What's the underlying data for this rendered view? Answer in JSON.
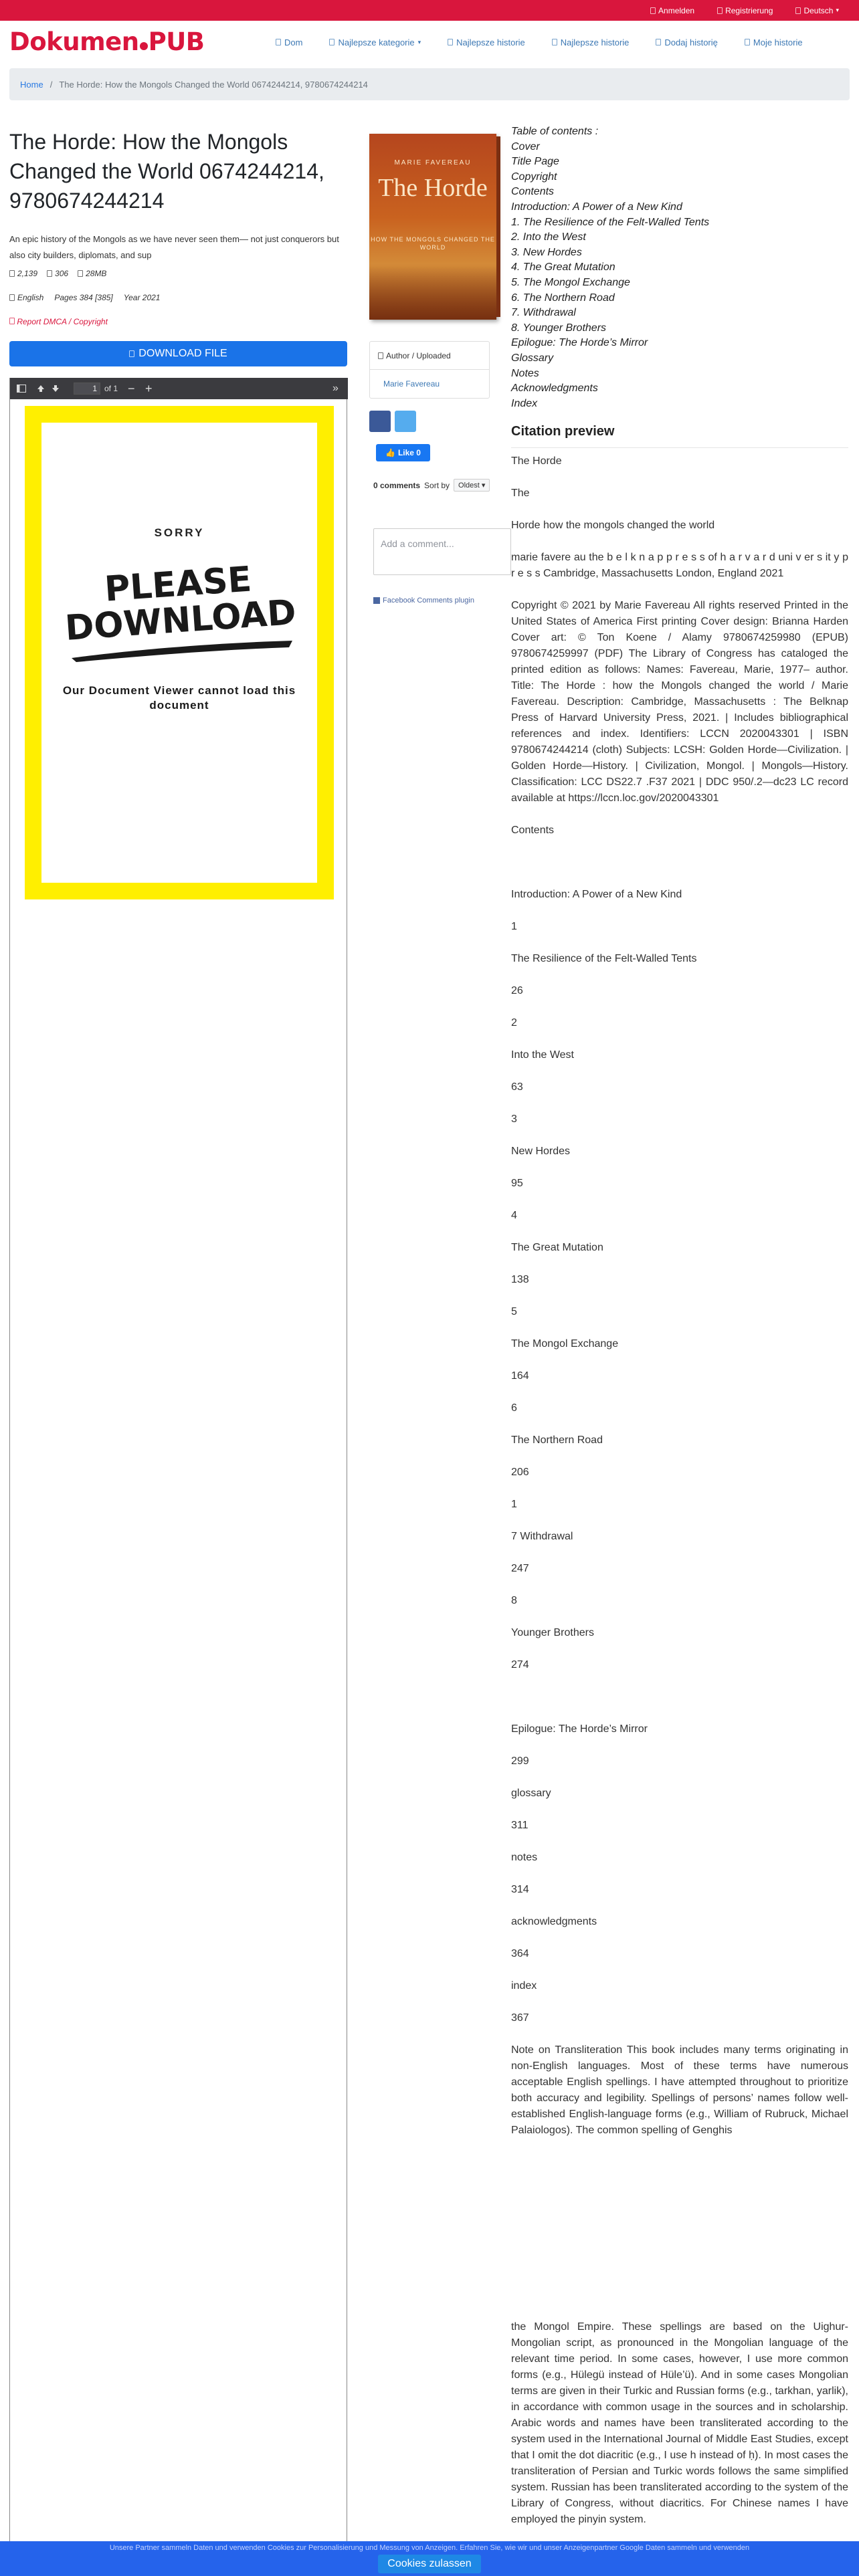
{
  "topbar": {
    "login": "Anmelden",
    "register": "Registrierung",
    "language": "Deutsch"
  },
  "logo": {
    "part1": "Dokumen",
    "part2": "PUB"
  },
  "nav": {
    "home": "Dom",
    "categories": "Najlepsze kategorie",
    "top_stories": "Najlepsze historie",
    "best_stories": "Najlepsze historie",
    "add_story": "Dodaj historię",
    "my_stories": "Moje historie"
  },
  "breadcrumb": {
    "home": "Home",
    "separator": "/",
    "current": "The Horde: How the Mongols Changed the World 0674244214, 9780674244214"
  },
  "book": {
    "title": "The Horde: How the Mongols Changed the World 0674244214, 9780674244214",
    "description": "An epic history of the Mongols as we have never seen them— not just conquerors but also city builders, diplomats, and sup",
    "views": "2,139",
    "downloads": "306",
    "size": "28MB",
    "language": "English",
    "pages": "Pages 384 [385]",
    "year": "Year 2021",
    "report": "Report DMCA / Copyright",
    "download_button": "DOWNLOAD FILE"
  },
  "viewer": {
    "page_current": "1",
    "page_total": "of 1",
    "sorry": "SORRY",
    "please_download": "PLEASE DOWNLOAD",
    "cannot_load": "Our Document Viewer cannot load this document"
  },
  "cover": {
    "author": "MARIE FAVEREAU",
    "title": "The Horde",
    "subtitle": "HOW THE MONGOLS CHANGED THE WORLD"
  },
  "author_card": {
    "heading": "Author / Uploaded",
    "name": "Marie Favereau"
  },
  "social": {
    "like": "Like 0",
    "comments_count": "0 comments",
    "sort_by": "Sort by",
    "sort_value": "Oldest",
    "comment_placeholder": "Add a comment...",
    "plugin": "Facebook Comments plugin"
  },
  "toc": {
    "heading": "Table of contents :",
    "items": [
      "Cover",
      "Title Page",
      "Copyright",
      "Contents",
      "Introduction: A Power of a New Kind",
      "1. The Resilience of the Felt-Walled Tents",
      "2. Into the West",
      "3. New Hordes",
      "4. The Great Mutation",
      "5. The Mongol Exchange",
      "6. The Northern Road",
      "7. Withdrawal",
      "8. Younger Brothers",
      "Epilogue: The Horde’s Mirror",
      "Glossary",
      "Notes",
      "Acknowledgments",
      "Index"
    ]
  },
  "citation": {
    "heading": "Citation preview",
    "paragraphs": [
      "The Horde",
      "The",
      "Horde how the mongols changed the world",
      "marie favere au the b e l k n a p p r e s s of h a r v a r d uni v er s it y p r e s s Cambridge, Massachusetts London, England 2021",
      "Copyright © 2021 by Marie Favereau All rights reserved Printed in the United States of America First printing Cover design: Brianna Harden Cover art: © Ton Koene / Alamy 9780674259980 (EPUB) 9780674259997 (PDF) The Library of Congress has cataloged the printed edition as follows: Names: Favereau, Marie, 1977– author. Title: The Horde : how the Mongols changed the world / Marie Favereau. Description: Cambridge, Massachusetts : The Belknap Press of Harvard University Press, 2021. | Includes bibliographical references and index. Identifiers: LCCN 2020043301 | ISBN 9780674244214 (cloth) Subjects: LCSH: Golden Horde—Civilization. | Golden Horde—History. | Civilization, Mongol. | Mongols—History. Classification: LCC DS22.7 .F37 2021 | DDC 950/.2—dc23 LC record available at https://lccn.loc.gov/2020043301",
      "Contents",
      "",
      "Introduction: A Power of a New Kind",
      "1",
      "The Resilience of the Felt-Walled Tents",
      "26",
      "2",
      "Into the West",
      "63",
      "3",
      "New Hordes",
      "95",
      "4",
      "The Great Mutation",
      "138",
      "5",
      "The Mongol Exchange",
      "164",
      "6",
      "The Northern Road",
      "206",
      "1",
      "7 Withdrawal",
      "247",
      "8",
      "Younger Brothers",
      "274",
      "",
      "Epilogue: The Horde’s Mirror",
      "299",
      "glossary",
      "311",
      "notes",
      "314",
      "acknowledgments",
      "364",
      "index",
      "367",
      "Note on Transliteration This book includes many terms originating in non-English languages. Most of these terms have numerous acceptable English spellings. I have attempted throughout to prioritize both accuracy and legibility. Spellings of persons’ names follow well-established English-language forms (e.g., William of Rubruck, Michael Palaiologos). The common spelling of Genghis"
    ],
    "continuation": "the Mongol Empire. These spellings are based on the Uighur-Mongolian script, as pronounced in the Mongolian language of the relevant time period. In some cases, however, I use more common forms (e.g., Hülegü instead of Hüle’ü). And in some cases Mongolian terms are given in their Turkic and Russian forms (e.g., tarkhan, yarlik), in accordance with common usage in the sources and in scholarship. Arabic words and names have been transliterated according to the system used in the International Journal of Middle East Studies, except that I omit the dot diacritic (e.g., I use h instead of ḥ). In most cases the transliteration of Persian and Turkic words follows the same simplified system. Russian has been transliterated according to the system of the Library of Congress, without diacritics. For Chinese names I have employed the pinyin system."
  },
  "cookie": {
    "text": "Unsere Partner sammeln Daten und verwenden Cookies zur Personalisierung und Messung von Anzeigen. Erfahren Sie, wie wir und unser Anzeigenpartner Google Daten sammeln und verwenden",
    "button": "Cookies zulassen"
  },
  "colors": {
    "brand": "#d9163d",
    "primary": "#1a73e8",
    "link": "#3c78b4",
    "viewer_bg": "#ffef00"
  }
}
